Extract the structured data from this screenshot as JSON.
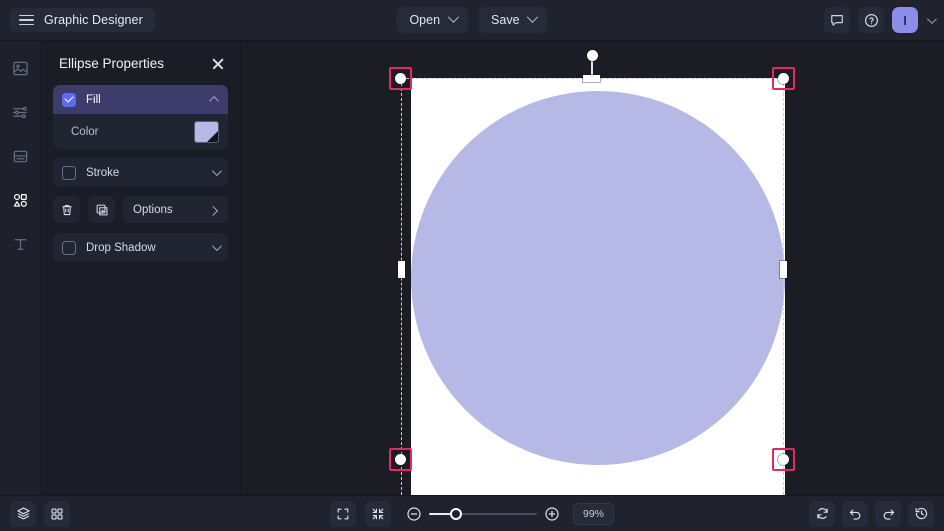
{
  "app": {
    "title": "Graphic Designer",
    "accent_purple": "#5b6cf0",
    "avatar_color": "#8b8ee8",
    "handle_highlight": "#e8275e",
    "canvas_bg": "#1b1c24",
    "artboard_color": "#ffffff"
  },
  "topbar": {
    "menu_icon": "hamburger-icon",
    "open_label": "Open",
    "save_label": "Save",
    "open_caret": "chevron-down-icon",
    "save_caret": "chevron-down-icon",
    "comment_icon": "comment-icon",
    "help_icon": "help-circle-icon",
    "avatar_initial": "I",
    "avatar_caret": "chevron-down-icon"
  },
  "rail": {
    "items": [
      {
        "name": "image-icon",
        "label": "Image",
        "active": false
      },
      {
        "name": "adjustments-icon",
        "label": "Adjust",
        "active": false
      },
      {
        "name": "layout-icon",
        "label": "Layout",
        "active": false
      },
      {
        "name": "shapes-icon",
        "label": "Shapes",
        "active": true
      },
      {
        "name": "text-icon",
        "label": "Text",
        "active": false
      }
    ]
  },
  "panel": {
    "title": "Ellipse Properties",
    "close_icon": "close-icon",
    "fill": {
      "label": "Fill",
      "checked": true,
      "caret": "chevron-up-icon"
    },
    "color": {
      "label": "Color",
      "value": "#b6b8e6"
    },
    "stroke": {
      "label": "Stroke",
      "checked": false,
      "caret": "chevron-down-icon"
    },
    "actions": {
      "delete_icon": "trash-icon",
      "duplicate_icon": "duplicate-icon",
      "options_label": "Options",
      "options_caret": "chevron-right-icon"
    },
    "drop_shadow": {
      "label": "Drop Shadow",
      "checked": false,
      "caret": "chevron-down-icon"
    }
  },
  "canvas": {
    "shape": "ellipse",
    "fill_color": "#b6b8e6",
    "selected": true,
    "rotation_handle": "rotate-handle",
    "corner_handles": [
      "top-left",
      "top-right",
      "bottom-left",
      "bottom-right"
    ],
    "edge_handles": [
      "top-center",
      "left-middle",
      "right-middle",
      "bottom-center"
    ]
  },
  "bottombar": {
    "layers_icon": "layers-icon",
    "grid_icon": "grid-icon",
    "fullscreen_icon": "fullscreen-icon",
    "fit_icon": "fit-to-screen-icon",
    "zoom_out_icon": "zoom-out-icon",
    "zoom_in_icon": "zoom-in-icon",
    "zoom_value": "99%",
    "slider_percent": 25,
    "refresh_icon": "refresh-icon",
    "undo_icon": "undo-icon",
    "redo_icon": "redo-icon",
    "history_icon": "history-icon"
  }
}
